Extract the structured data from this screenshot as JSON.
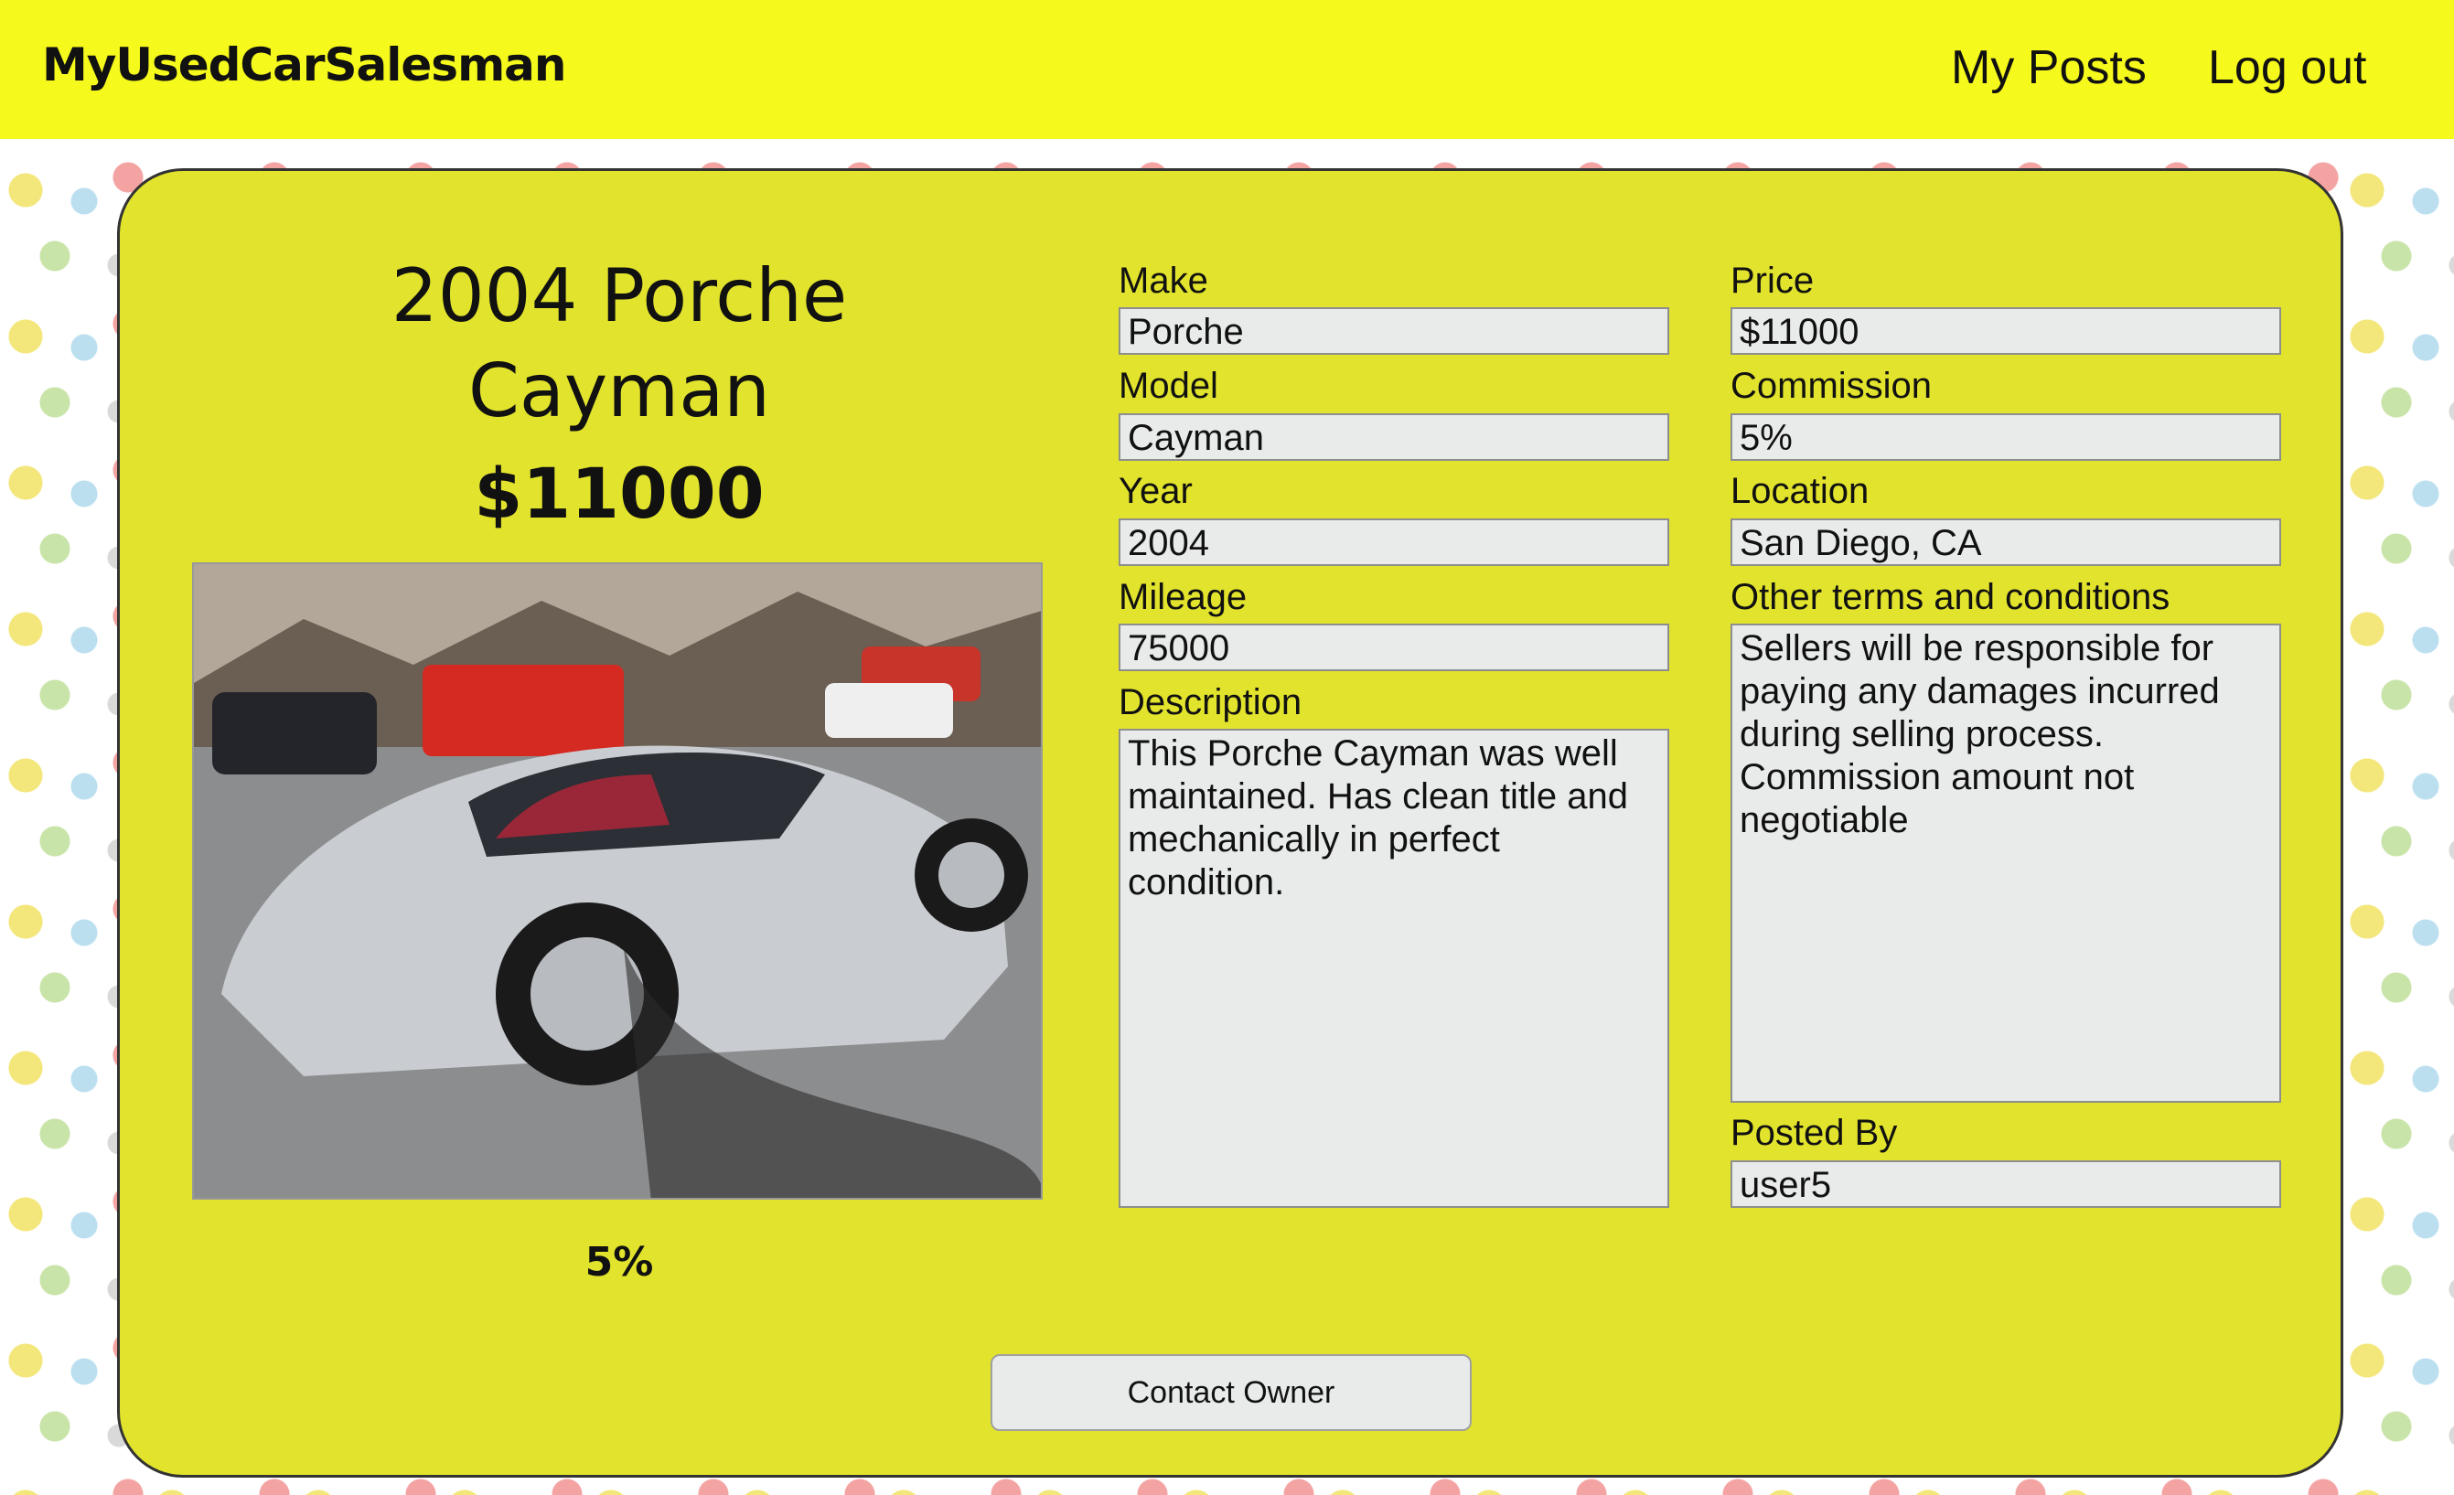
{
  "header": {
    "brand": "MyUsedCarSalesman",
    "nav": {
      "my_posts": "My Posts",
      "log_out": "Log out"
    }
  },
  "listing": {
    "title": "2004 Porche Cayman",
    "price_display": "$11000",
    "commission_display": "5%",
    "photo_icon": "car-photo"
  },
  "fields": {
    "make": {
      "label": "Make",
      "value": "Porche"
    },
    "model": {
      "label": "Model",
      "value": "Cayman"
    },
    "year": {
      "label": "Year",
      "value": "2004"
    },
    "mileage": {
      "label": "Mileage",
      "value": "75000"
    },
    "description": {
      "label": "Description",
      "value": "This Porche Cayman was well maintained. Has clean title and mechanically in perfect condition."
    },
    "price": {
      "label": "Price",
      "value": "$11000"
    },
    "commission": {
      "label": "Commission",
      "value": "5%"
    },
    "location": {
      "label": "Location",
      "value": "San Diego, CA"
    },
    "terms": {
      "label": "Other terms and conditions",
      "value": "Sellers will be responsible for paying any damages incurred during selling process. Commission amount not negotiable"
    },
    "posted_by": {
      "label": "Posted By",
      "value": "user5"
    }
  },
  "actions": {
    "contact_owner": "Contact Owner"
  },
  "colors": {
    "header_bg": "#f6f91c",
    "card_bg": "#e2e32c",
    "field_bg": "#e9ebea"
  }
}
